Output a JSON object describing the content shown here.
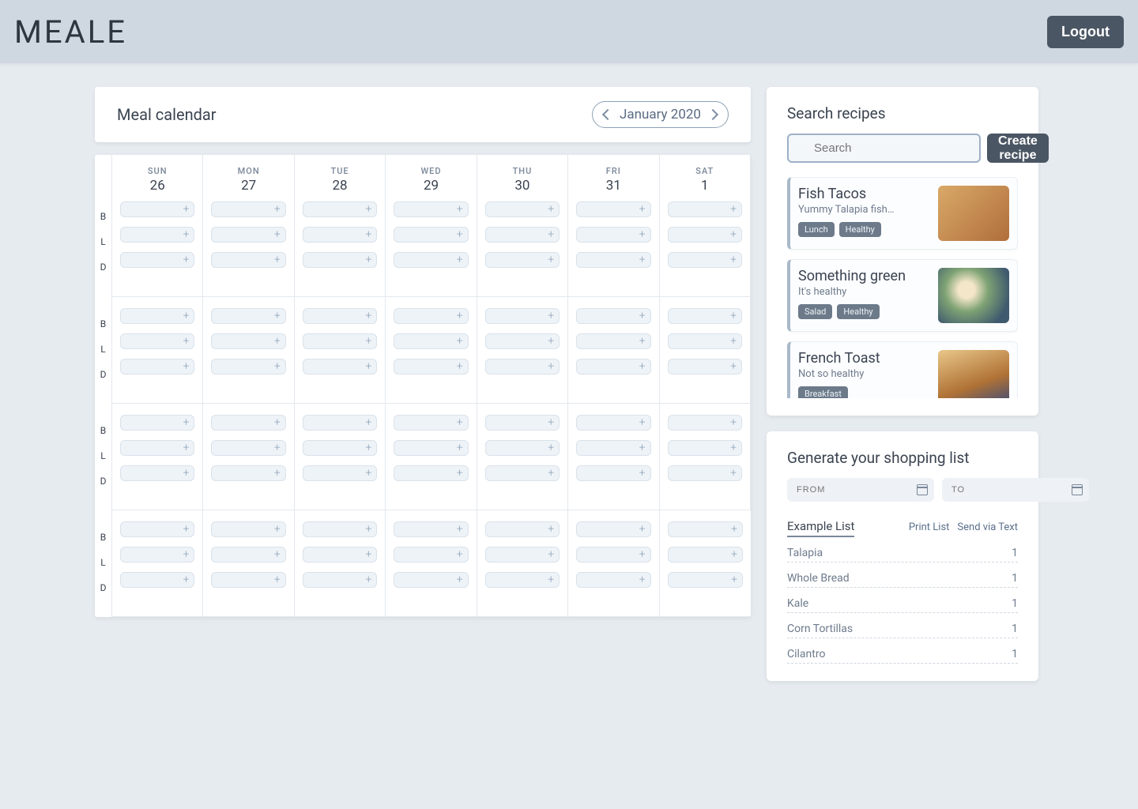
{
  "header": {
    "brand": "MEALE",
    "logout": "Logout"
  },
  "calendar": {
    "title": "Meal calendar",
    "month_label": "January 2020",
    "dow": [
      "SUN",
      "MON",
      "TUE",
      "WED",
      "THU",
      "FRI",
      "SAT"
    ],
    "dates": [
      26,
      27,
      28,
      29,
      30,
      31,
      1
    ],
    "meal_letters": [
      "B",
      "L",
      "D"
    ],
    "weeks_below_header": 3
  },
  "search": {
    "title": "Search recipes",
    "placeholder": "Search",
    "create_label": "Create recipe",
    "recipes": [
      {
        "name": "Fish Tacos",
        "desc": "Yummy Talapia fish…",
        "tags": [
          "Lunch",
          "Healthy"
        ]
      },
      {
        "name": "Something green",
        "desc": "It's healthy",
        "tags": [
          "Salad",
          "Healthy"
        ]
      },
      {
        "name": "French Toast",
        "desc": "Not so healthy",
        "tags": [
          "Breakfast"
        ]
      }
    ]
  },
  "shopping": {
    "title": "Generate your shopping list",
    "from_placeholder": "FROM",
    "to_placeholder": "TO",
    "list_title": "Example List",
    "print_label": "Print List",
    "send_label": "Send via Text",
    "items": [
      {
        "name": "Talapia",
        "qty": 1
      },
      {
        "name": "Whole Bread",
        "qty": 1
      },
      {
        "name": "Kale",
        "qty": 1
      },
      {
        "name": "Corn Tortillas",
        "qty": 1
      },
      {
        "name": "Cilantro",
        "qty": 1
      }
    ]
  }
}
